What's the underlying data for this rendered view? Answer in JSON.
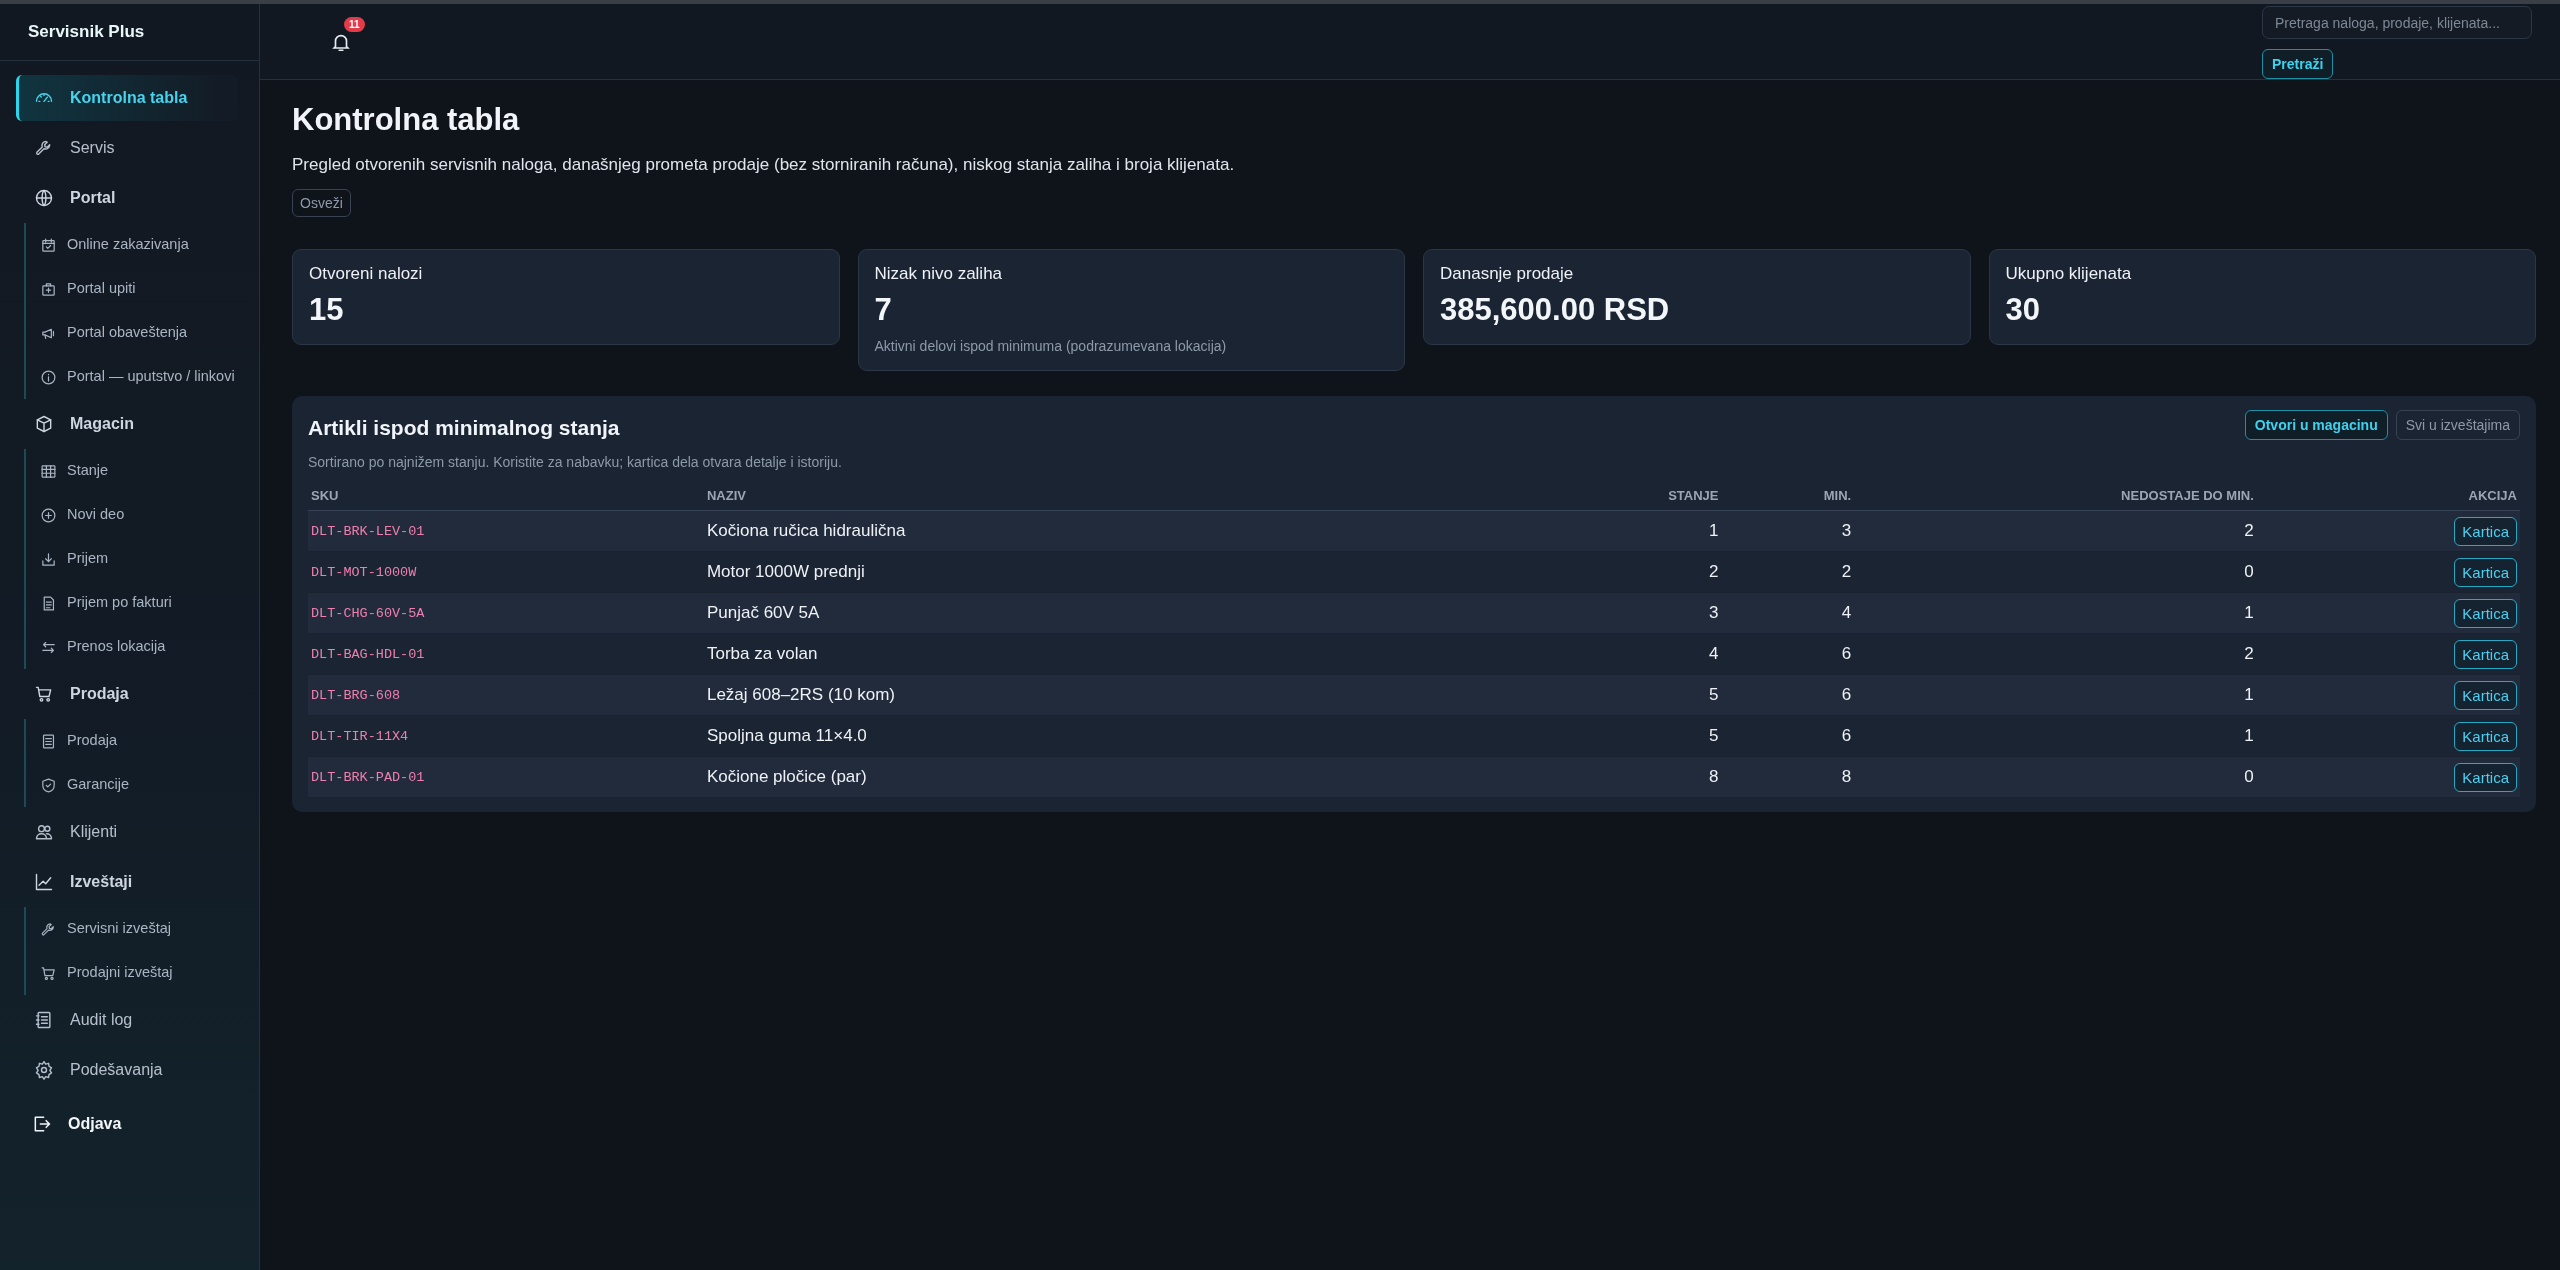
{
  "sidebar": {
    "brand": "Servisnik Plus",
    "items": [
      {
        "kind": "link",
        "label": "Kontrolna tabla",
        "selected": true
      },
      {
        "kind": "link",
        "label": "Servis",
        "selected": false
      },
      {
        "kind": "group",
        "label": "Portal",
        "selected": false,
        "children": [
          {
            "label": "Online zakazivanja",
            "selected": false
          },
          {
            "label": "Portal upiti",
            "selected": false
          },
          {
            "label": "Portal obaveštenja",
            "selected": false
          },
          {
            "label": "Portal — uputstvo / linkovi",
            "selected": false
          }
        ]
      },
      {
        "kind": "group",
        "label": "Magacin",
        "selected": false,
        "children": [
          {
            "label": "Stanje",
            "selected": false
          },
          {
            "label": "Novi deo",
            "selected": false
          },
          {
            "label": "Prijem",
            "selected": false
          },
          {
            "label": "Prijem po fakturi",
            "selected": false
          },
          {
            "label": "Prenos lokacija",
            "selected": false
          }
        ]
      },
      {
        "kind": "group",
        "label": "Prodaja",
        "selected": false,
        "children": [
          {
            "label": "Prodaja",
            "selected": false
          },
          {
            "label": "Garancije",
            "selected": false
          }
        ]
      },
      {
        "kind": "link",
        "label": "Klijenti",
        "selected": false
      },
      {
        "kind": "group",
        "label": "Izveštaji",
        "selected": false,
        "children": [
          {
            "label": "Servisni izveštaj",
            "selected": false
          },
          {
            "label": "Prodajni izveštaj",
            "selected": false
          }
        ]
      },
      {
        "kind": "link",
        "label": "Audit log",
        "selected": false
      },
      {
        "kind": "link",
        "label": "Podešavanja",
        "selected": false
      }
    ],
    "logout": "Odjava"
  },
  "header": {
    "notification_count": "11",
    "search": {
      "placeholder": "Pretraga naloga, prodaje, klijenata..."
    },
    "search_button": "Pretraži"
  },
  "page": {
    "title": "Kontrolna tabla",
    "description": "Pregled otvorenih servisnih naloga, današnjeg prometa prodaje (bez storniranih računa), niskog stanja zaliha i broja klijenata.",
    "refresh_button": "Osveži"
  },
  "stats": [
    {
      "label": "Otvoreni nalozi",
      "value": "15"
    },
    {
      "label": "Nizak nivo zaliha",
      "value": "7",
      "note": "Aktivni delovi ispod minimuma (podrazumevana lokacija)"
    },
    {
      "label": "Danasnje prodaje",
      "value": "385,600.00 RSD"
    },
    {
      "label": "Ukupno klijenata",
      "value": "30"
    }
  ],
  "low_stock": {
    "title": "Artikli ispod minimalnog stanja",
    "subtitle": "Sortirano po najnižem stanju. Koristite za nabavku; kartica dela otvara detalje i istoriju.",
    "buttons": [
      {
        "label": "Otvori u magacinu",
        "kind": "primary"
      },
      {
        "label": "Svi u izveštajima",
        "kind": "secondary"
      }
    ],
    "columns": [
      "SKU",
      "NAZIV",
      "STANJE",
      "MIN.",
      "NEDOSTAJE DO MIN.",
      "AKCIJA"
    ],
    "rows": [
      {
        "sku": "DLT-BRK-LEV-01",
        "name": "Kočiona ručica hidraulična",
        "stock": "1",
        "min": "3",
        "missing": "2",
        "action": "Kartica"
      },
      {
        "sku": "DLT-MOT-1000W",
        "name": "Motor 1000W prednji",
        "stock": "2",
        "min": "2",
        "missing": "0",
        "action": "Kartica"
      },
      {
        "sku": "DLT-CHG-60V-5A",
        "name": "Punjač 60V 5A",
        "stock": "3",
        "min": "4",
        "missing": "1",
        "action": "Kartica"
      },
      {
        "sku": "DLT-BAG-HDL-01",
        "name": "Torba za volan",
        "stock": "4",
        "min": "6",
        "missing": "2",
        "action": "Kartica"
      },
      {
        "sku": "DLT-BRG-608",
        "name": "Ležaj 608–2RS (10 kom)",
        "stock": "5",
        "min": "6",
        "missing": "1",
        "action": "Kartica"
      },
      {
        "sku": "DLT-TIR-11X4",
        "name": "Spoljna guma 11×4.0",
        "stock": "5",
        "min": "6",
        "missing": "1",
        "action": "Kartica"
      },
      {
        "sku": "DLT-BRK-PAD-01",
        "name": "Kočione pločice (par)",
        "stock": "8",
        "min": "8",
        "missing": "0",
        "action": "Kartica"
      }
    ]
  }
}
